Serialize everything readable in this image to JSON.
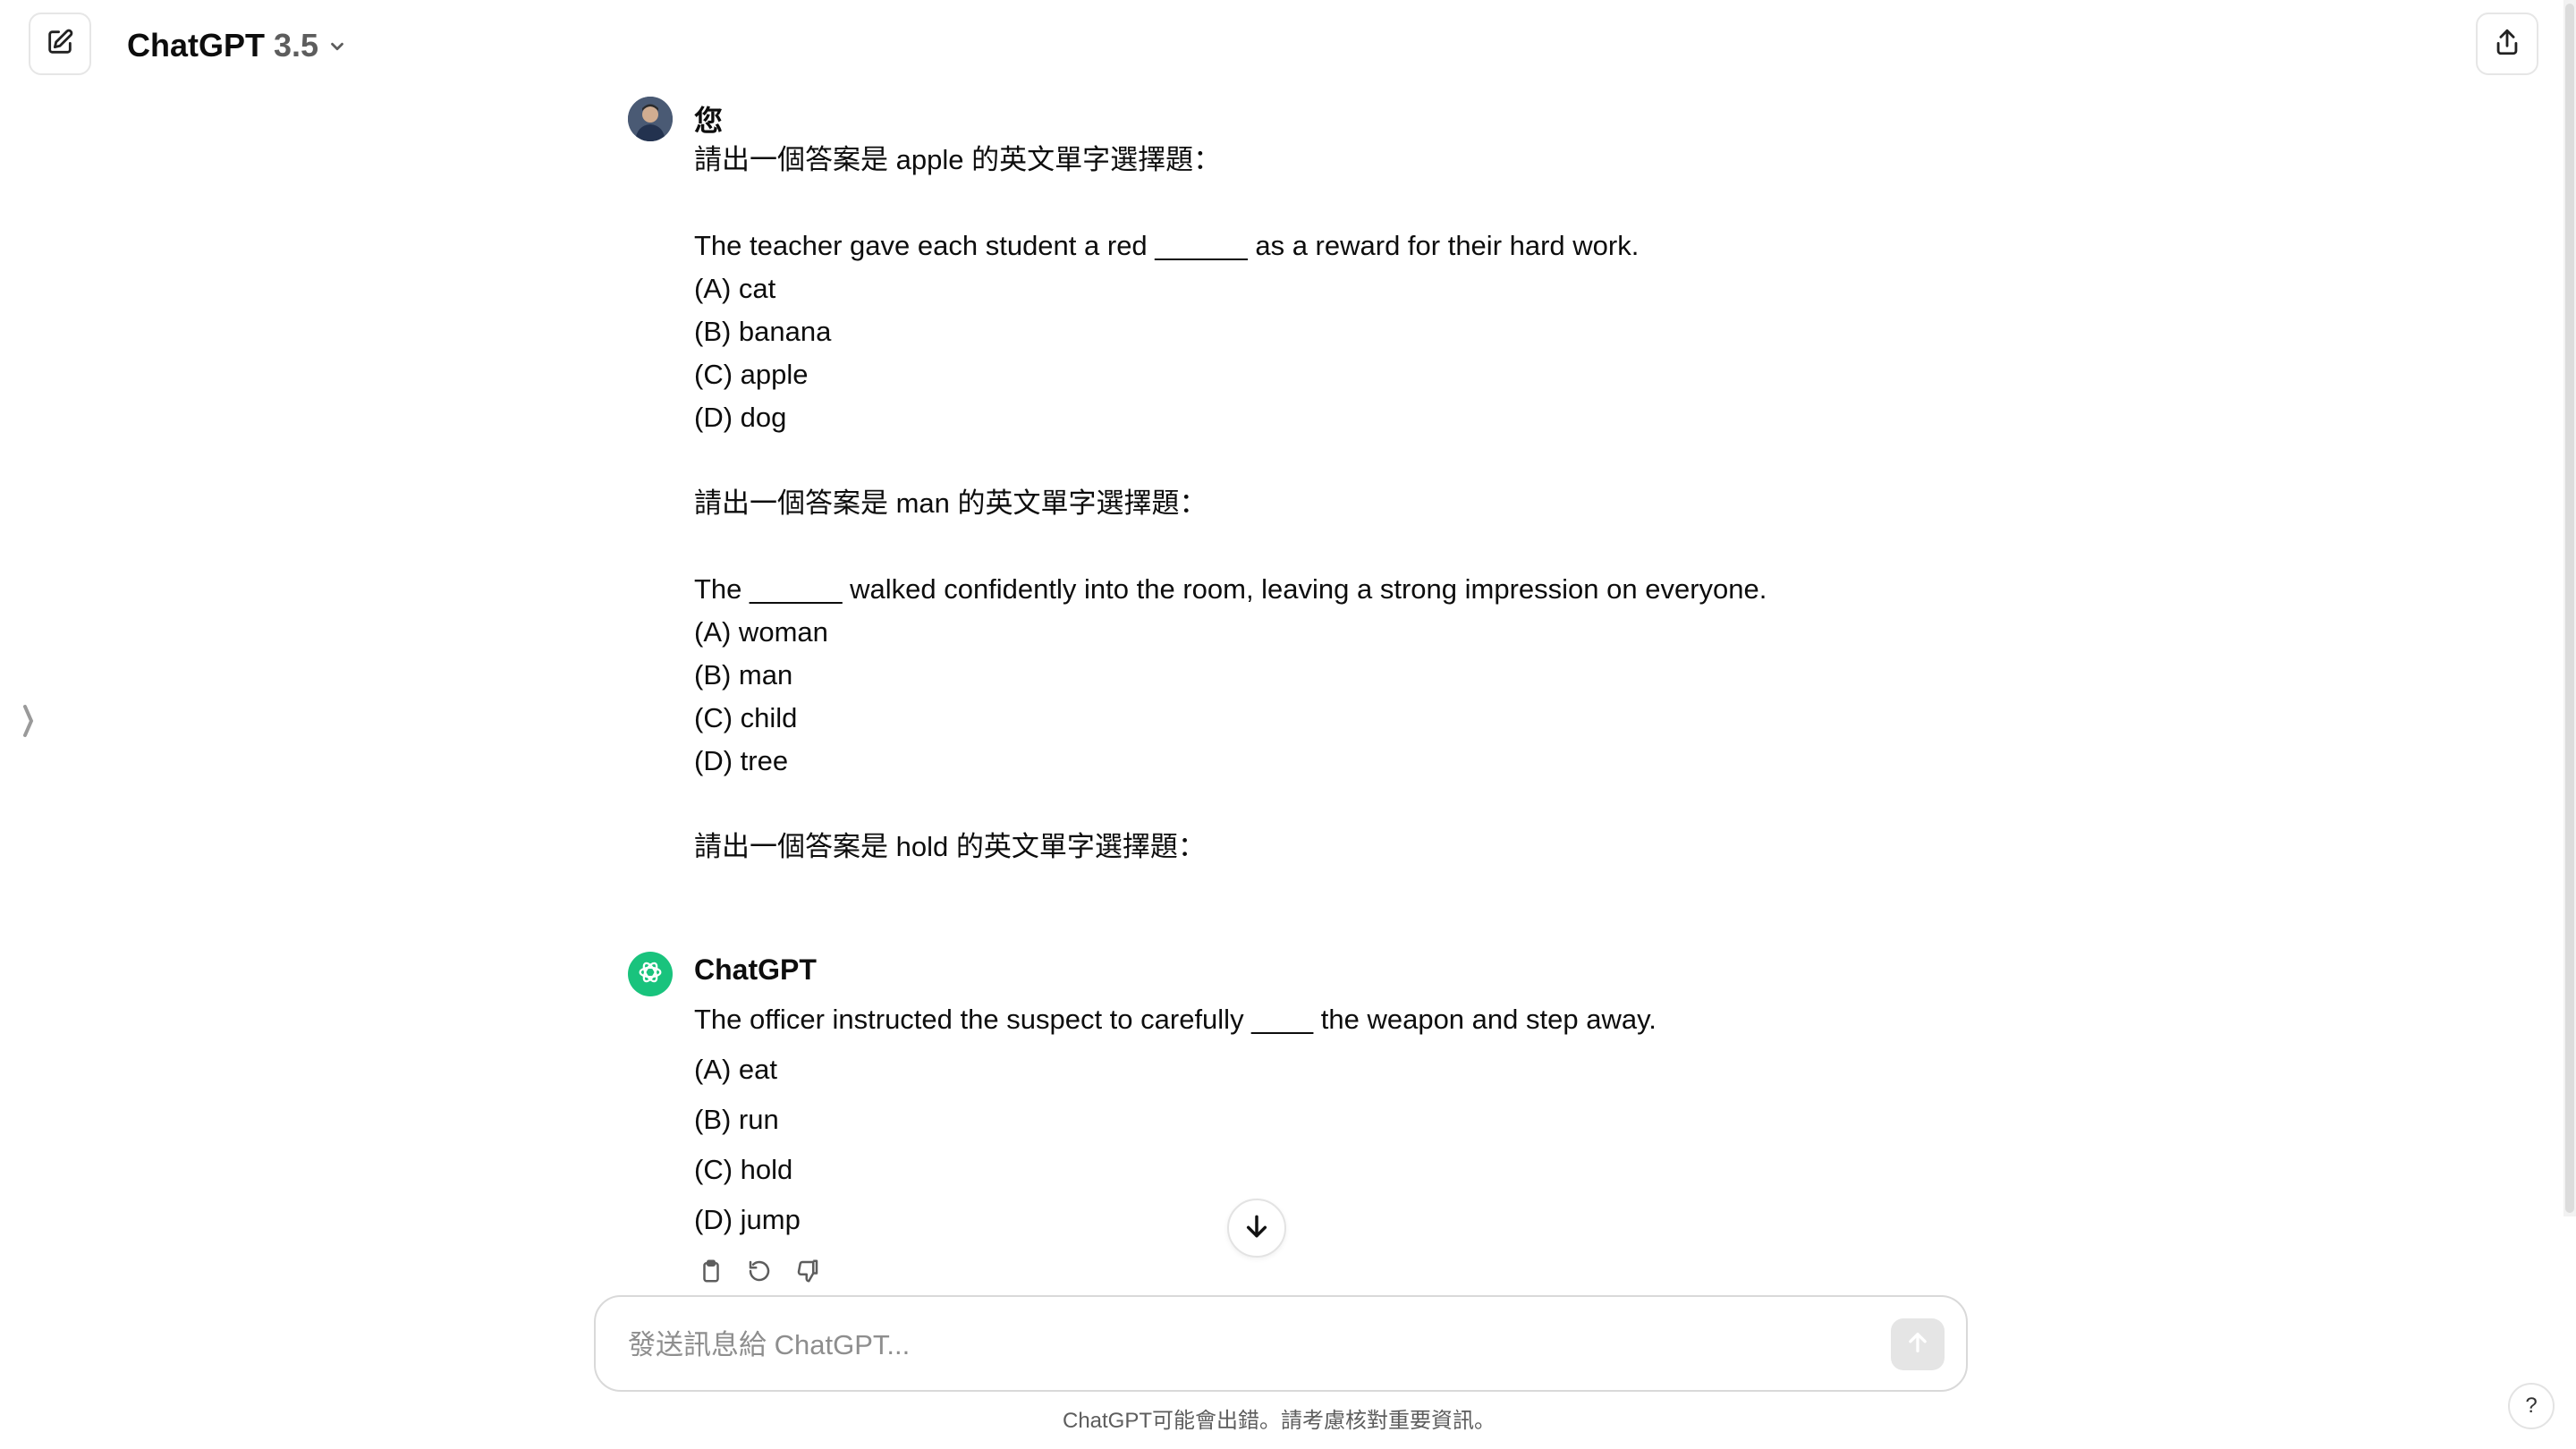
{
  "header": {
    "model_name": "ChatGPT",
    "model_version": "3.5",
    "new_chat_icon": "edit-pencil-icon",
    "share_icon": "share-upload-icon"
  },
  "conversation": {
    "user_message": {
      "author": "您",
      "lines": [
        "請出一個答案是 apple 的英文單字選擇題：",
        "",
        "The teacher gave each student a red ______ as a reward for their hard work.",
        "(A) cat",
        "(B) banana",
        "(C) apple",
        "(D) dog",
        "",
        "請出一個答案是 man 的英文單字選擇題：",
        "",
        "The ______ walked confidently into the room, leaving a strong impression on everyone.",
        "(A) woman",
        "(B) man",
        "(C) child",
        "(D) tree",
        "",
        "請出一個答案是 hold 的英文單字選擇題："
      ]
    },
    "assistant_message": {
      "author": "ChatGPT",
      "lines": [
        "The officer instructed the suspect to carefully ____ the weapon and step away.",
        "(A) eat",
        "(B) run",
        "(C) hold",
        "(D) jump"
      ],
      "action_icons": [
        "copy-icon",
        "regenerate-icon",
        "thumbs-down-icon"
      ]
    }
  },
  "composer": {
    "placeholder": "發送訊息給 ChatGPT...",
    "value": ""
  },
  "footer": {
    "disclaimer": "ChatGPT可能會出錯。請考慮核對重要資訊。",
    "help_label": "?"
  },
  "colors": {
    "assistant_avatar": "#19c37d",
    "border": "#e6e6e6",
    "muted_text": "#5d5d5d"
  }
}
